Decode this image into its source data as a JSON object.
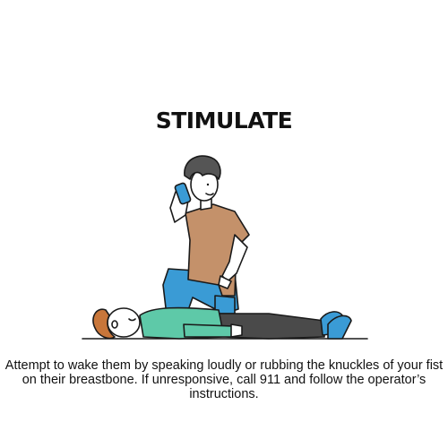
{
  "title": "STIMULATE",
  "caption": "Attempt to wake them by speaking loudly or rubbing the knuckles of your fist on their breastbone. If unresponsive, call 911 and follow the operator’s instructions.",
  "illustration": {
    "icon": "cpr-responder-calling-illustration",
    "colors": {
      "responder_shirt": "#c4916a",
      "responder_pants": "#3a9bd5",
      "phone": "#3a9bd5",
      "victim_shirt": "#5ec9a8",
      "victim_pants": "#4a4a4a",
      "victim_shoes": "#3a9bd5",
      "hair": "#555555",
      "victim_hair": "#c8763a",
      "skin": "#ffffff",
      "outline": "#1a1a1a"
    }
  }
}
